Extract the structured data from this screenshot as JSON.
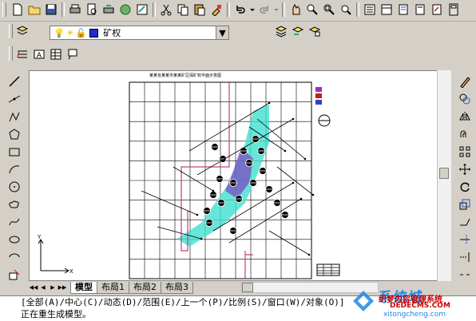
{
  "toolbar_standard": {
    "icons": [
      "new-icon",
      "open-icon",
      "save-icon",
      "print-icon",
      "print-preview-icon",
      "publish-icon",
      "3d-publish-icon",
      "etransmit-icon",
      "cut-icon",
      "copy-icon",
      "paste-icon",
      "match-properties-icon",
      "undo-icon",
      "redo-icon",
      "pan-icon",
      "zoom-realtime-icon",
      "zoom-window-icon",
      "zoom-previous-icon",
      "properties-icon",
      "design-center-icon",
      "tool-palettes-icon",
      "sheet-set-icon",
      "markup-icon",
      "calculator-icon"
    ]
  },
  "layers": {
    "current_layer": "矿权",
    "color": "#1f2bd1"
  },
  "drawing": {
    "title": "某某省某某市某某矿区探矿权平面示意图",
    "grid_cols": 12,
    "grid_rows": 10
  },
  "tabs": {
    "items": [
      "模型",
      "布局1",
      "布局2",
      "布局3"
    ],
    "active": "模型"
  },
  "ucs": {
    "x_label": "X",
    "y_label": "Y"
  },
  "command_line": {
    "line1": "[全部(A)/中心(C)/动态(D)/范围(E)/上一个(P)/比例(S)/窗口(W)/对象(O)]",
    "line2": "正在重生成模型。"
  },
  "watermark": {
    "brand": "系统城",
    "url": "xitongcheng.com",
    "text2": "织梦内容管理系统",
    "text3": "DEDECMS.COM"
  }
}
